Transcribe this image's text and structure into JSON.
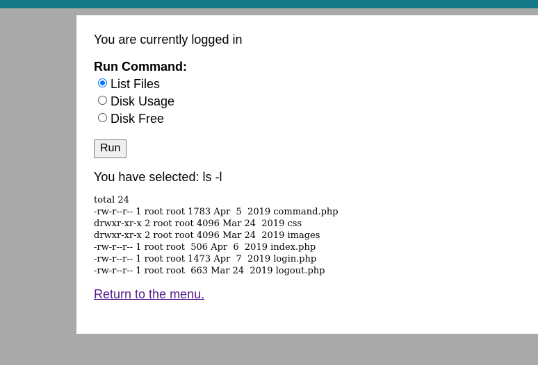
{
  "status_text": "You are currently logged in",
  "form": {
    "heading": "Run Command:",
    "options": [
      {
        "label": "List Files",
        "checked": true
      },
      {
        "label": "Disk Usage",
        "checked": false
      },
      {
        "label": "Disk Free",
        "checked": false
      }
    ],
    "run_label": "Run"
  },
  "selected_text": "You have selected: ls -l",
  "output_lines": [
    "total 24",
    "-rw-r--r-- 1 root root 1783 Apr  5  2019 command.php",
    "drwxr-xr-x 2 root root 4096 Mar 24  2019 css",
    "drwxr-xr-x 2 root root 4096 Mar 24  2019 images",
    "-rw-r--r-- 1 root root  506 Apr  6  2019 index.php",
    "-rw-r--r-- 1 root root 1473 Apr  7  2019 login.php",
    "-rw-r--r-- 1 root root  663 Mar 24  2019 logout.php"
  ],
  "return_link": "Return to the menu.",
  "colors": {
    "topbar": "#147a87",
    "background": "#a9a9a9",
    "link_visited": "#551a8b",
    "radio_accent": "#0075ff"
  }
}
